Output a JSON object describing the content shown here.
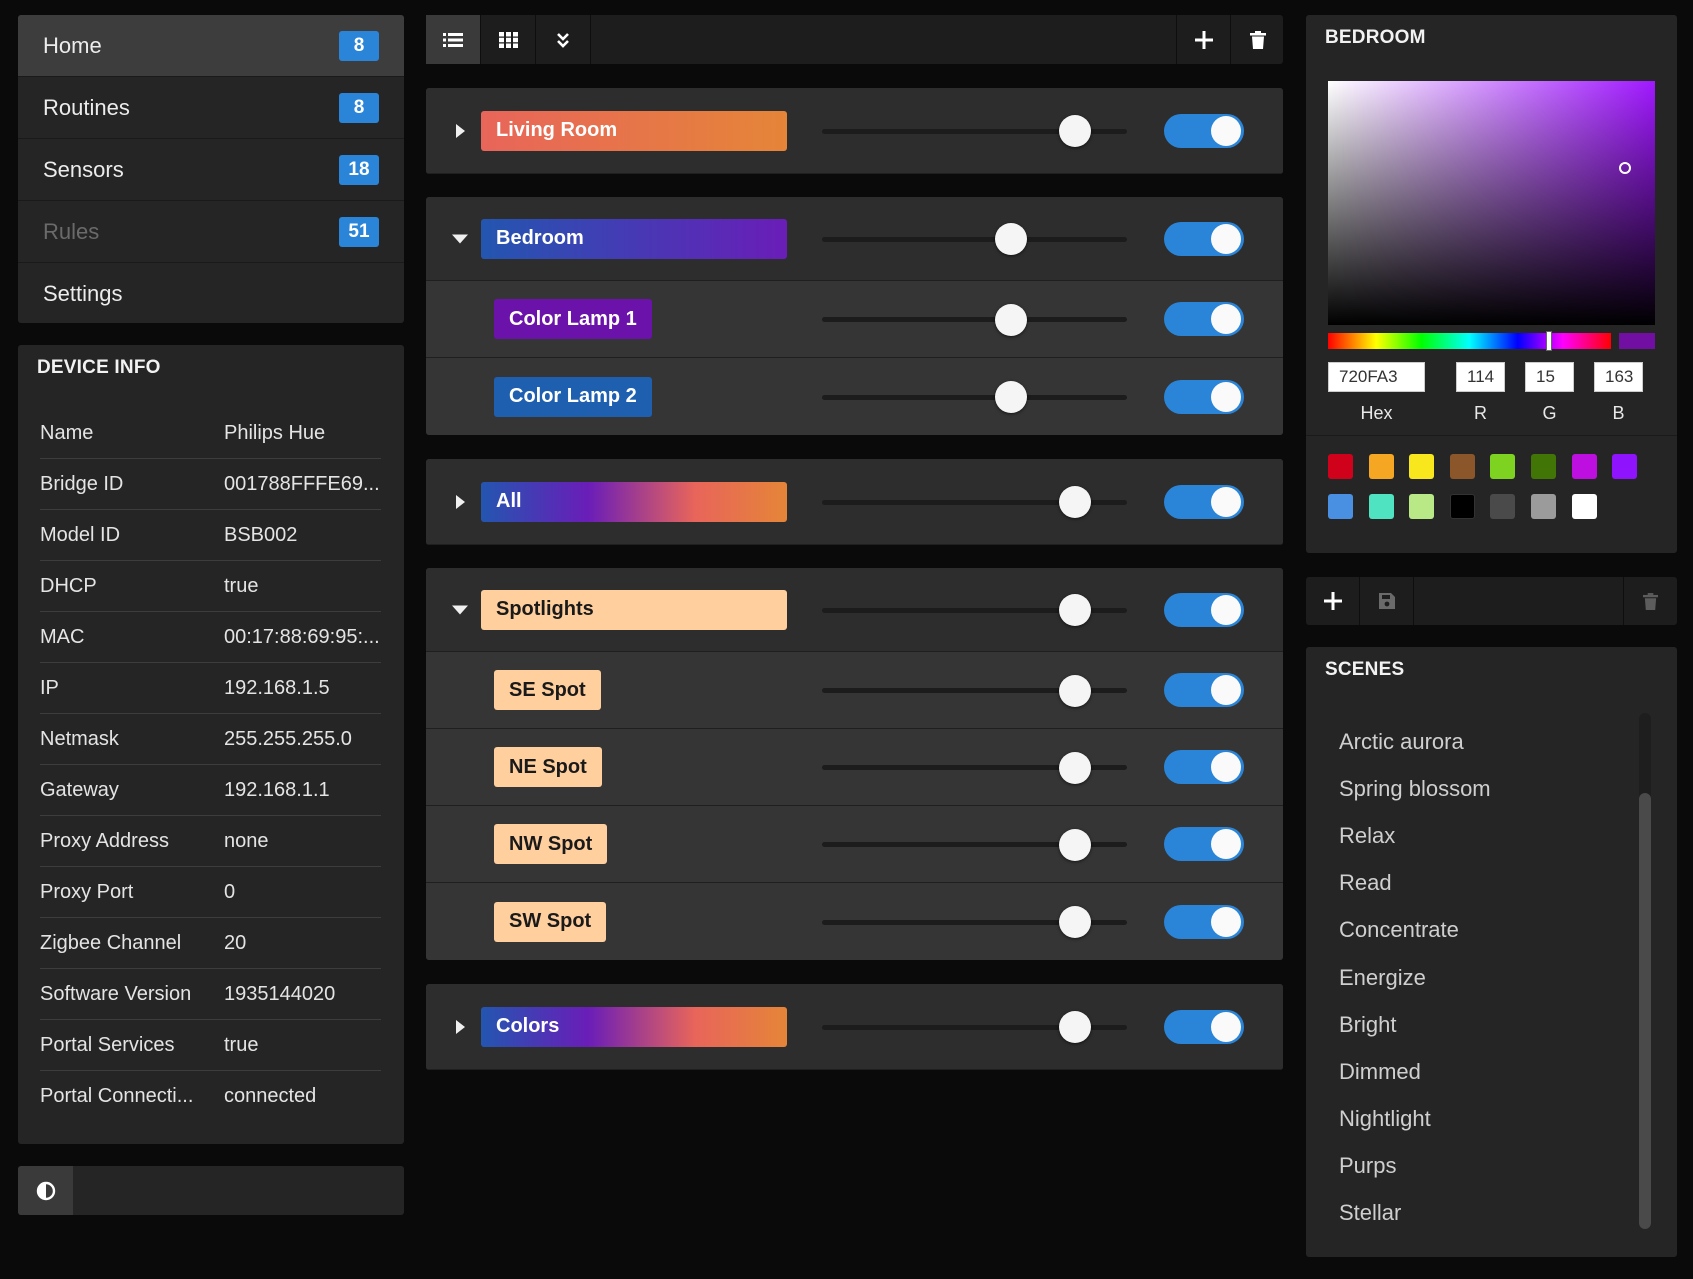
{
  "nav": {
    "items": [
      {
        "label": "Home",
        "badge": "8"
      },
      {
        "label": "Routines",
        "badge": "8"
      },
      {
        "label": "Sensors",
        "badge": "18"
      },
      {
        "label": "Rules",
        "badge": "51"
      },
      {
        "label": "Settings",
        "badge": ""
      }
    ]
  },
  "device_info": {
    "title": "DEVICE INFO",
    "rows": [
      {
        "key": "Name",
        "value": "Philips Hue"
      },
      {
        "key": "Bridge ID",
        "value": "001788FFFE69..."
      },
      {
        "key": "Model ID",
        "value": "BSB002"
      },
      {
        "key": "DHCP",
        "value": "true"
      },
      {
        "key": "MAC",
        "value": "00:17:88:69:95:..."
      },
      {
        "key": "IP",
        "value": "192.168.1.5"
      },
      {
        "key": "Netmask",
        "value": "255.255.255.0"
      },
      {
        "key": "Gateway",
        "value": "192.168.1.1"
      },
      {
        "key": "Proxy Address",
        "value": "none"
      },
      {
        "key": "Proxy Port",
        "value": "0"
      },
      {
        "key": "Zigbee Channel",
        "value": "20"
      },
      {
        "key": "Software Version",
        "value": "1935144020"
      },
      {
        "key": "Portal Services",
        "value": "true"
      },
      {
        "key": "Portal Connecti...",
        "value": "connected"
      }
    ]
  },
  "toolbar": {
    "list_view_icon": "list-icon",
    "grid_view_icon": "grid-icon",
    "collapse_icon": "double-chevron-down-icon",
    "add_icon": "plus-icon",
    "delete_icon": "trash-icon"
  },
  "groups": {
    "living_room": {
      "label": "Living Room",
      "brightness": 0.83,
      "on": true,
      "expanded": false
    },
    "bedroom": {
      "label": "Bedroom",
      "brightness": 0.62,
      "on": true,
      "expanded": true,
      "lights": [
        {
          "label": "Color Lamp 1",
          "brightness": 0.62,
          "on": true
        },
        {
          "label": "Color Lamp 2",
          "brightness": 0.62,
          "on": true
        }
      ]
    },
    "all": {
      "label": "All",
      "brightness": 0.83,
      "on": true,
      "expanded": false
    },
    "spotlights": {
      "label": "Spotlights",
      "brightness": 0.83,
      "on": true,
      "expanded": true,
      "lights": [
        {
          "label": "SE Spot",
          "brightness": 0.83,
          "on": true
        },
        {
          "label": "NE Spot",
          "brightness": 0.83,
          "on": true
        },
        {
          "label": "NW Spot",
          "brightness": 0.83,
          "on": true
        },
        {
          "label": "SW Spot",
          "brightness": 0.83,
          "on": true
        }
      ]
    },
    "colors": {
      "label": "Colors",
      "brightness": 0.83,
      "on": true,
      "expanded": false
    }
  },
  "picker": {
    "title": "BEDROOM",
    "hex": "720FA3",
    "r": "114",
    "g": "15",
    "b": "163",
    "hex_label": "Hex",
    "r_label": "R",
    "g_label": "G",
    "b_label": "B",
    "saturation": 0.91,
    "value": 0.64,
    "hue_deg": 281,
    "current_color": "#720FA3",
    "swatches": [
      "#d0021b",
      "#f5a623",
      "#f8e71c",
      "#8b572a",
      "#7ed321",
      "#417505",
      "#bd10e0",
      "#9013fe",
      "#4a90e2",
      "#50e3c2",
      "#b8e986",
      "#000000",
      "#4a4a4a",
      "#9b9b9b",
      "#ffffff"
    ]
  },
  "scene_toolbar": {
    "add_icon": "plus-icon",
    "save_icon": "floppy-disk-icon",
    "delete_icon": "trash-icon"
  },
  "scenes": {
    "title": "SCENES",
    "items": [
      "Arctic aurora",
      "Spring blossom",
      "Relax",
      "Read",
      "Concentrate",
      "Energize",
      "Bright",
      "Dimmed",
      "Nightlight",
      "Purps",
      "Stellar"
    ]
  },
  "colors": {
    "accent": "#2a85d8",
    "living_room_gradient": [
      "#e8655a",
      "#e58538"
    ],
    "bedroom_gradient": [
      "#2356b0",
      "#6a1db8"
    ],
    "color_lamp_1": "#6b12aa",
    "color_lamp_2": "#1f5fb0",
    "spotlight": "#ffcf9e",
    "all_gradient": [
      "#2356b0",
      "#6a1db8",
      "#e8655a",
      "#e58538"
    ]
  }
}
